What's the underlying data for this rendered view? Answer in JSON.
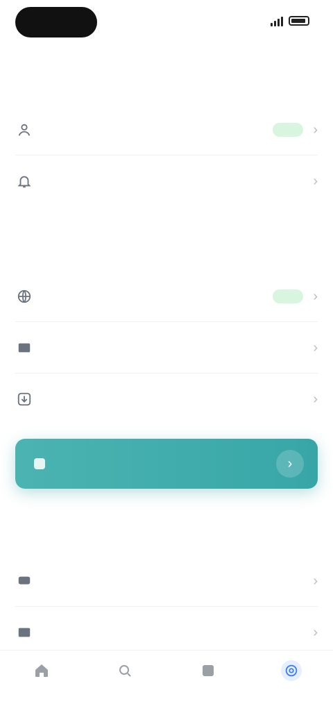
{
  "status": {},
  "header": {
    "title": ""
  },
  "account": {
    "rows": [
      {
        "icon": "user-icon",
        "label": "",
        "badge": ""
      },
      {
        "icon": "bell-icon",
        "label": ""
      }
    ]
  },
  "content": {
    "header": "",
    "rows": [
      {
        "icon": "globe-icon",
        "label": "",
        "badge": ""
      },
      {
        "icon": "film-icon",
        "label": ""
      },
      {
        "icon": "download-icon",
        "label": ""
      }
    ]
  },
  "banner": {
    "icon": "star-icon",
    "label": "",
    "accent": "#3fadac"
  },
  "support": {
    "header": "",
    "rows": [
      {
        "icon": "chat-icon",
        "label": ""
      },
      {
        "icon": "book-icon",
        "label": ""
      }
    ]
  },
  "tabs": [
    {
      "icon": "home-icon",
      "label": "",
      "active": false
    },
    {
      "icon": "search-icon",
      "label": "",
      "active": false
    },
    {
      "icon": "library-icon",
      "label": "",
      "active": false
    },
    {
      "icon": "settings-icon",
      "label": "",
      "active": true,
      "color": "#3b7ef6"
    }
  ],
  "colors": {
    "badge_bg": "#d8f5df",
    "badge_text": "#1f9d47",
    "accent": "#3fadac",
    "active_tab": "#3b7ef6"
  }
}
